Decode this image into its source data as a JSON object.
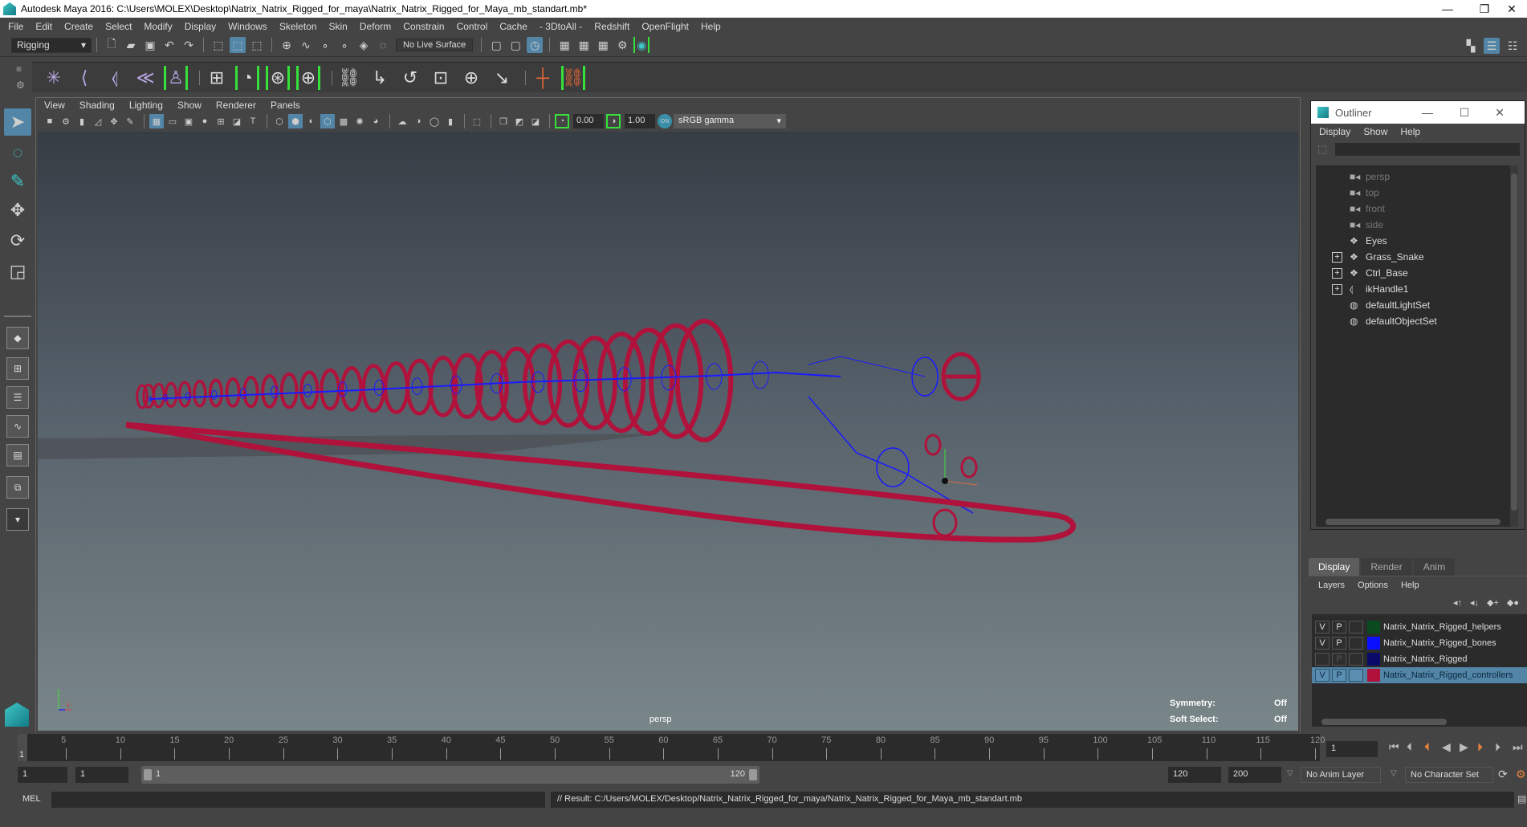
{
  "window": {
    "title": "Autodesk Maya 2016: C:\\Users\\MOLEX\\Desktop\\Natrix_Natrix_Rigged_for_maya\\Natrix_Natrix_Rigged_for_Maya_mb_standart.mb*",
    "minimize": "—",
    "restore": "❐",
    "close": "✕"
  },
  "menubar": [
    "File",
    "Edit",
    "Create",
    "Select",
    "Modify",
    "Display",
    "Windows",
    "Skeleton",
    "Skin",
    "Deform",
    "Constrain",
    "Control",
    "Cache",
    "- 3DtoAll -",
    "Redshift",
    "OpenFlight",
    "Help"
  ],
  "statusline": {
    "menuset": "Rigging",
    "live_surface": "No Live Surface"
  },
  "shelf": {
    "icons": [
      "joint-tool",
      "ik-handle",
      "ik-spline",
      "bind-skin",
      "humanik",
      "paint-weights",
      "smooth-bind",
      "lattice",
      "cluster",
      "parent-constraint",
      "point-constraint",
      "orient-constraint",
      "scale-constraint",
      "aim-constraint",
      "pole-vector",
      "red-cross",
      "orange-constraint"
    ]
  },
  "toolbox": {
    "tools": [
      "select-tool",
      "lasso-tool",
      "paint-select-tool",
      "move-tool",
      "rotate-tool",
      "scale-tool"
    ]
  },
  "panel": {
    "menu": [
      "View",
      "Shading",
      "Lighting",
      "Show",
      "Renderer",
      "Panels"
    ],
    "exposure": "0.00",
    "gamma": "1.00",
    "colorspace": "sRGB gamma",
    "camera_label": "persp",
    "hud": {
      "symmetry_label": "Symmetry:",
      "symmetry_value": "Off",
      "soft_select_label": "Soft Select:",
      "soft_select_value": "Off"
    },
    "colors": {
      "controllers": "#b0123c",
      "bones": "#1a1aff"
    }
  },
  "outliner": {
    "title": "Outliner",
    "menu": [
      "Display",
      "Show",
      "Help"
    ],
    "items": [
      {
        "label": "persp",
        "icon": "camera-icon",
        "dim": true,
        "expandable": false
      },
      {
        "label": "top",
        "icon": "camera-icon",
        "dim": true,
        "expandable": false
      },
      {
        "label": "front",
        "icon": "camera-icon",
        "dim": true,
        "expandable": false
      },
      {
        "label": "side",
        "icon": "camera-icon",
        "dim": true,
        "expandable": false
      },
      {
        "label": "Eyes",
        "icon": "group-icon",
        "dim": false,
        "expandable": false
      },
      {
        "label": "Grass_Snake",
        "icon": "group-icon",
        "dim": false,
        "expandable": true
      },
      {
        "label": "Ctrl_Base",
        "icon": "group-icon",
        "dim": false,
        "expandable": true
      },
      {
        "label": "ikHandle1",
        "icon": "ik-handle-icon",
        "dim": false,
        "expandable": true
      },
      {
        "label": "defaultLightSet",
        "icon": "set-icon",
        "dim": false,
        "expandable": false
      },
      {
        "label": "defaultObjectSet",
        "icon": "set-icon",
        "dim": false,
        "expandable": false
      }
    ]
  },
  "layer_editor": {
    "tabs": [
      "Display",
      "Render",
      "Anim"
    ],
    "active_tab": "Display",
    "menu": [
      "Layers",
      "Options",
      "Help"
    ],
    "layers": [
      {
        "v": "V",
        "p": "P",
        "name": "Natrix_Natrix_Rigged_helpers",
        "color": "#0a4a1f",
        "selected": false
      },
      {
        "v": "V",
        "p": "P",
        "name": "Natrix_Natrix_Rigged_bones",
        "color": "#0a10ff",
        "selected": false
      },
      {
        "v": "",
        "p": "P",
        "name": "Natrix_Natrix_Rigged",
        "color": "#0a0a6a",
        "selected": false
      },
      {
        "v": "V",
        "p": "P",
        "name": "Natrix_Natrix_Rigged_controllers",
        "color": "#b0123c",
        "selected": true
      }
    ]
  },
  "timeline": {
    "ticks": [
      "5",
      "10",
      "15",
      "20",
      "25",
      "30",
      "35",
      "40",
      "45",
      "50",
      "55",
      "60",
      "65",
      "70",
      "75",
      "80",
      "85",
      "90",
      "95",
      "100",
      "105",
      "110",
      "115",
      "120"
    ],
    "current_marker": "1",
    "current_frame": "1"
  },
  "range": {
    "start": "1",
    "playback_start": "1",
    "slider_start": "1",
    "slider_end": "120",
    "playback_end": "120",
    "end": "200",
    "anim_layer": "No Anim Layer",
    "character_set": "No Character Set"
  },
  "command": {
    "mode": "MEL",
    "result": "// Result: C:/Users/MOLEX/Desktop/Natrix_Natrix_Rigged_for_maya/Natrix_Natrix_Rigged_for_Maya_mb_standart.mb"
  }
}
